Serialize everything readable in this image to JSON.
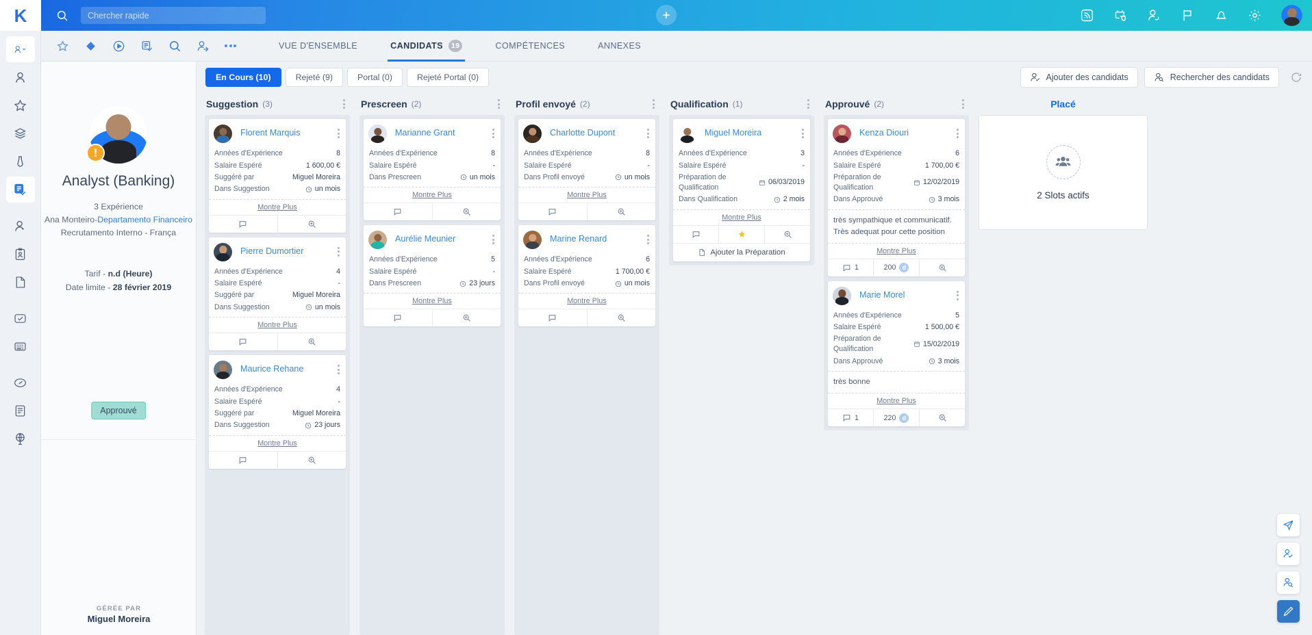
{
  "topbar": {
    "brand": "K",
    "search_placeholder": "Chercher rapide",
    "search_value": "",
    "add_icon": "plus-icon",
    "icons": [
      "rss-icon",
      "calendar-icon",
      "add-person-icon",
      "flag-icon",
      "bell-icon",
      "gear-icon"
    ],
    "avatar": "user-avatar"
  },
  "toolbar": {
    "icons": [
      "star-icon",
      "diamond-icon",
      "play-circle-icon",
      "task-list-icon",
      "search-icon",
      "person-search-icon",
      "more-icon"
    ]
  },
  "tabs": [
    {
      "label": "VUE D'ENSEMBLE",
      "badge": "",
      "active": false
    },
    {
      "label": "CANDIDATS",
      "badge": "19",
      "active": true
    },
    {
      "label": "COMPÉTENCES",
      "badge": "",
      "active": false
    },
    {
      "label": "ANNEXES",
      "badge": "",
      "active": false
    }
  ],
  "rail": {
    "items": [
      {
        "name": "person-dropdown",
        "icon": "person-chevron-icon",
        "selected": true,
        "blue": true
      },
      {
        "name": "person",
        "icon": "person-icon",
        "selected": false,
        "blue": false
      },
      {
        "name": "favorites",
        "icon": "star-icon",
        "selected": false,
        "blue": false
      },
      {
        "name": "layers",
        "icon": "layers-icon",
        "selected": false,
        "blue": false
      },
      {
        "name": "tie",
        "icon": "tie-icon",
        "selected": false,
        "blue": false
      },
      {
        "name": "job-check",
        "icon": "job-check-icon",
        "selected": true,
        "blue": true
      },
      {
        "name": "contact",
        "icon": "contact-icon",
        "selected": false,
        "blue": false
      },
      {
        "name": "badge",
        "icon": "id-badge-icon",
        "selected": false,
        "blue": false
      },
      {
        "name": "document",
        "icon": "document-icon",
        "selected": false,
        "blue": false
      },
      {
        "name": "approval",
        "icon": "check-box-icon",
        "selected": false,
        "blue": false
      },
      {
        "name": "calculator",
        "icon": "calculator-icon",
        "selected": false,
        "blue": false
      },
      {
        "name": "gauge",
        "icon": "gauge-icon",
        "selected": false,
        "blue": false
      },
      {
        "name": "report",
        "icon": "report-icon",
        "selected": false,
        "blue": false
      },
      {
        "name": "globe",
        "icon": "globe-icon",
        "selected": false,
        "blue": false
      }
    ]
  },
  "profile": {
    "title": "Analyst (Banking)",
    "experience": "3 Expérience",
    "owner_prefix": "Ana Monteiro-",
    "owner_link": "Departamento Financeiro",
    "source": "Recrutamento Interno  -  França",
    "rate_label": "Tarif  - ",
    "rate_value": "n.d  (Heure)",
    "deadline_label": "Date limite  - ",
    "deadline_value": "28 février 2019",
    "status": "Approuvé",
    "managed_by_label": "GÉRÉE PAR",
    "managed_by_name": "Miguel Moreira"
  },
  "filters": [
    {
      "label": "En Cours (10)",
      "active": true
    },
    {
      "label": "Rejeté (9)",
      "active": false
    },
    {
      "label": "Portal (0)",
      "active": false
    },
    {
      "label": "Rejeté Portal (0)",
      "active": false
    }
  ],
  "actions": {
    "add_candidates": "Ajouter des candidats",
    "search_candidates": "Rechercher des candidats",
    "refresh_icon": "refresh-icon"
  },
  "board": {
    "columns": [
      {
        "title": "Suggestion",
        "count": "(3)",
        "cards": [
          {
            "name": "Florent Marquis",
            "rows": [
              {
                "label": "Années d'Expérience",
                "value": "8",
                "icon": ""
              },
              {
                "label": "Salaire Espéré",
                "value": "1 600,00 €",
                "icon": ""
              },
              {
                "label": "Suggéré par",
                "value": "Miguel Moreira",
                "icon": ""
              },
              {
                "label": "Dans Suggestion",
                "value": "un mois",
                "icon": "clock"
              }
            ],
            "note": "",
            "more": "Montre Plus",
            "footer": [
              {
                "icon": "comment",
                "label": ""
              },
              {
                "icon": "zoom",
                "label": ""
              }
            ],
            "add_action": ""
          },
          {
            "name": "Pierre Dumortier",
            "rows": [
              {
                "label": "Années d'Expérience",
                "value": "4",
                "icon": ""
              },
              {
                "label": "Salaire Espéré",
                "value": "-",
                "icon": ""
              },
              {
                "label": "Suggéré par",
                "value": "Miguel Moreira",
                "icon": ""
              },
              {
                "label": "Dans Suggestion",
                "value": "un mois",
                "icon": "clock"
              }
            ],
            "note": "",
            "more": "Montre Plus",
            "footer": [
              {
                "icon": "comment",
                "label": ""
              },
              {
                "icon": "zoom",
                "label": ""
              }
            ],
            "add_action": ""
          },
          {
            "name": "Maurice Rehane",
            "rows": [
              {
                "label": "Années d'Expérience",
                "value": "4",
                "icon": ""
              },
              {
                "label": "Salaire Espéré",
                "value": "-",
                "icon": ""
              },
              {
                "label": "Suggéré par",
                "value": "Miguel Moreira",
                "icon": ""
              },
              {
                "label": "Dans Suggestion",
                "value": "23 jours",
                "icon": "clock"
              }
            ],
            "note": "",
            "more": "Montre Plus",
            "footer": [
              {
                "icon": "comment",
                "label": ""
              },
              {
                "icon": "zoom",
                "label": ""
              }
            ],
            "add_action": ""
          }
        ]
      },
      {
        "title": "Prescreen",
        "count": "(2)",
        "cards": [
          {
            "name": "Marianne Grant",
            "rows": [
              {
                "label": "Années d'Expérience",
                "value": "8",
                "icon": ""
              },
              {
                "label": "Salaire Espéré",
                "value": "-",
                "icon": ""
              },
              {
                "label": "Dans Prescreen",
                "value": "un mois",
                "icon": "clock"
              }
            ],
            "note": "",
            "more": "Montre Plus",
            "footer": [
              {
                "icon": "comment",
                "label": ""
              },
              {
                "icon": "zoom",
                "label": ""
              }
            ],
            "add_action": ""
          },
          {
            "name": "Aurélie Meunier",
            "rows": [
              {
                "label": "Années d'Expérience",
                "value": "5",
                "icon": ""
              },
              {
                "label": "Salaire Espéré",
                "value": "-",
                "icon": ""
              },
              {
                "label": "Dans Prescreen",
                "value": "23 jours",
                "icon": "clock"
              }
            ],
            "note": "",
            "more": "Montre Plus",
            "footer": [
              {
                "icon": "comment",
                "label": ""
              },
              {
                "icon": "zoom",
                "label": ""
              }
            ],
            "add_action": ""
          }
        ]
      },
      {
        "title": "Profil envoyé",
        "count": "(2)",
        "cards": [
          {
            "name": "Charlotte Dupont",
            "rows": [
              {
                "label": "Années d'Expérience",
                "value": "8",
                "icon": ""
              },
              {
                "label": "Salaire Espéré",
                "value": "-",
                "icon": ""
              },
              {
                "label": "Dans Profil envoyé",
                "value": "un mois",
                "icon": "clock"
              }
            ],
            "note": "",
            "more": "Montre Plus",
            "footer": [
              {
                "icon": "comment",
                "label": ""
              },
              {
                "icon": "zoom",
                "label": ""
              }
            ],
            "add_action": ""
          },
          {
            "name": "Marine Renard",
            "rows": [
              {
                "label": "Années d'Expérience",
                "value": "6",
                "icon": ""
              },
              {
                "label": "Salaire Espéré",
                "value": "1 700,00 €",
                "icon": ""
              },
              {
                "label": "Dans Profil envoyé",
                "value": "un mois",
                "icon": "clock"
              }
            ],
            "note": "",
            "more": "Montre Plus",
            "footer": [
              {
                "icon": "comment",
                "label": ""
              },
              {
                "icon": "zoom",
                "label": ""
              }
            ],
            "add_action": ""
          }
        ]
      },
      {
        "title": "Qualification",
        "count": "(1)",
        "cards": [
          {
            "name": "Miguel Moreira",
            "rows": [
              {
                "label": "Années d'Expérience",
                "value": "3",
                "icon": ""
              },
              {
                "label": "Salaire Espéré",
                "value": "-",
                "icon": ""
              },
              {
                "label": "Préparation de Qualification",
                "value": "06/03/2019",
                "icon": "calendar"
              },
              {
                "label": "Dans Qualification",
                "value": "2 mois",
                "icon": "clock"
              }
            ],
            "note": "",
            "more": "Montre Plus",
            "footer": [
              {
                "icon": "comment",
                "label": ""
              },
              {
                "icon": "star",
                "label": ""
              },
              {
                "icon": "zoom",
                "label": ""
              }
            ],
            "add_action": "Ajouter la Préparation"
          }
        ]
      },
      {
        "title": "Approuvé",
        "count": "(2)",
        "cards": [
          {
            "name": "Kenza Diouri",
            "rows": [
              {
                "label": "Années d'Expérience",
                "value": "6",
                "icon": ""
              },
              {
                "label": "Salaire Espéré",
                "value": "1 700,00 €",
                "icon": ""
              },
              {
                "label": "Préparation de Qualification",
                "value": "12/02/2019",
                "icon": "calendar"
              },
              {
                "label": "Dans Approuvé",
                "value": "3 mois",
                "icon": "clock"
              }
            ],
            "note": "très sympathique et communicatif. Très adequat pour cette position",
            "more": "Montre Plus",
            "footer": [
              {
                "icon": "comment",
                "label": "1"
              },
              {
                "icon": "score",
                "label": "200"
              },
              {
                "icon": "zoom",
                "label": ""
              }
            ],
            "add_action": ""
          },
          {
            "name": "Marie Morel",
            "rows": [
              {
                "label": "Années d'Expérience",
                "value": "5",
                "icon": ""
              },
              {
                "label": "Salaire Espéré",
                "value": "1 500,00 €",
                "icon": ""
              },
              {
                "label": "Préparation de Qualification",
                "value": "15/02/2019",
                "icon": "calendar"
              },
              {
                "label": "Dans Approuvé",
                "value": "3 mois",
                "icon": "clock"
              }
            ],
            "note": "très bonne",
            "more": "Montre Plus",
            "footer": [
              {
                "icon": "comment",
                "label": "1"
              },
              {
                "icon": "score",
                "label": "220"
              },
              {
                "icon": "zoom",
                "label": ""
              }
            ],
            "add_action": ""
          }
        ]
      }
    ],
    "placed": {
      "title": "Placé",
      "slots_text": "2 Slots actifs",
      "icon": "people-group-icon"
    }
  },
  "fabs": [
    {
      "name": "send-icon",
      "primary": false
    },
    {
      "name": "add-person-check-icon",
      "primary": false
    },
    {
      "name": "search-person-icon",
      "primary": false
    },
    {
      "name": "edit-pencil-icon",
      "primary": true
    }
  ],
  "colors": {
    "accent_blue": "#1569e8",
    "link_blue": "#3a8ad6",
    "status_green": "#9fdcd3",
    "badge_orange": "#f5a623",
    "star_yellow": "#f5c518"
  }
}
